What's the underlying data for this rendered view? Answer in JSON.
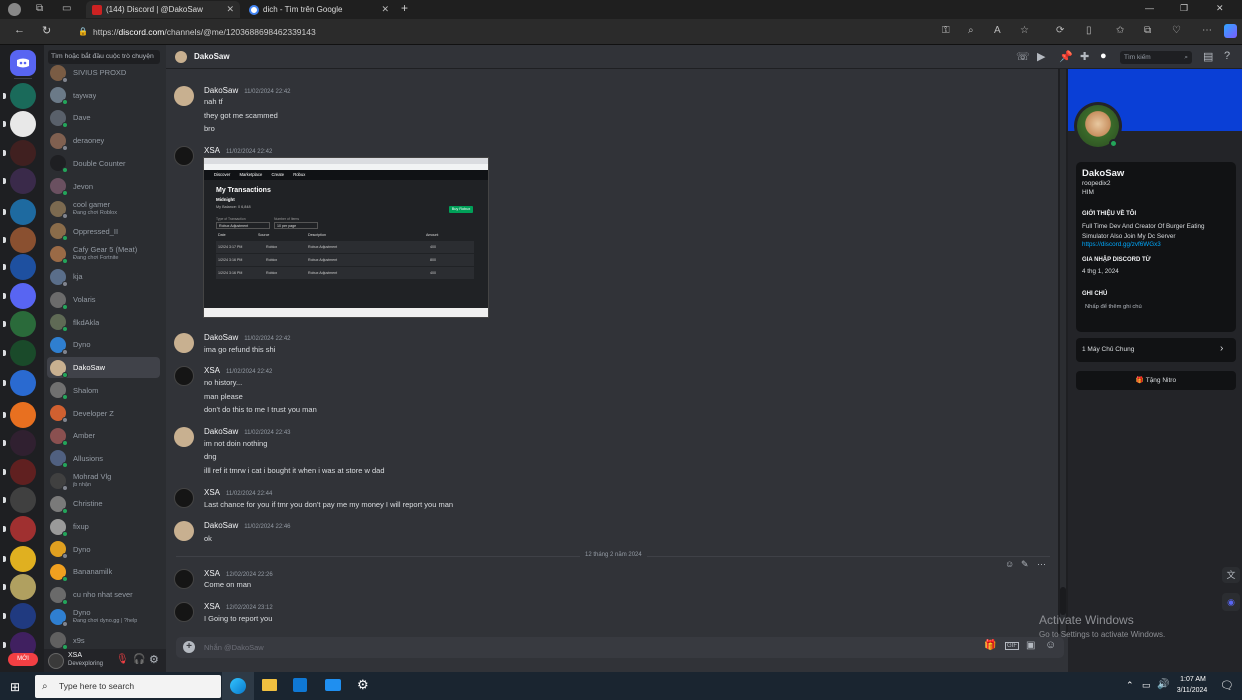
{
  "browser": {
    "tabs": [
      {
        "title": "(144) Discord | @DakoSaw"
      },
      {
        "title": "dich - Tìm trên Google"
      }
    ],
    "url": "https://discord.com/channels/@me/1203688698462339143",
    "url_host": "discord.com",
    "url_prefix": "https://",
    "url_path": "/channels/@me/1203688698462339143"
  },
  "dm_sidebar": {
    "search_placeholder": "Tìm hoặc bắt đầu cuộc trò chuyện",
    "items": [
      {
        "name": "SIVIUS PROXD",
        "sub": "",
        "color": "#7a5c44"
      },
      {
        "name": "tayway",
        "sub": "",
        "color": "#6b7a88"
      },
      {
        "name": "Dave",
        "sub": "",
        "color": "#59606a"
      },
      {
        "name": "deraoney",
        "sub": "",
        "color": "#806050"
      },
      {
        "name": "Double Counter",
        "sub": "",
        "color": "#1e1f22"
      },
      {
        "name": "Jevon",
        "sub": "",
        "color": "#6a5060"
      },
      {
        "name": "cool gamer",
        "sub": "Đang chơi Roblox",
        "color": "#7c6a50"
      },
      {
        "name": "Oppressed_II",
        "sub": "",
        "color": "#8a6c4a"
      },
      {
        "name": "Cafy Gear 5 (Meat)",
        "sub": "Đang chơi Fortnite",
        "color": "#9a6a46"
      },
      {
        "name": "kja",
        "sub": "",
        "color": "#5a6e8a"
      },
      {
        "name": "Volaris",
        "sub": "",
        "color": "#6b6b6b"
      },
      {
        "name": "flkdAkla",
        "sub": "",
        "color": "#5f6a55"
      },
      {
        "name": "Dyno",
        "sub": "",
        "color": "#2f7fd0"
      },
      {
        "name": "DakoSaw",
        "sub": "",
        "color": "#c8b090"
      },
      {
        "name": "Shalom",
        "sub": "",
        "color": "#707070"
      },
      {
        "name": "Developer Z",
        "sub": "",
        "color": "#d06030"
      },
      {
        "name": "Amber",
        "sub": "",
        "color": "#8a5050"
      },
      {
        "name": "Allusions",
        "sub": "",
        "color": "#506080"
      },
      {
        "name": "Mohrad Vlg",
        "sub": "jb nhận",
        "color": "#404040"
      },
      {
        "name": "Christine",
        "sub": "",
        "color": "#7a7a7a"
      },
      {
        "name": "fixup",
        "sub": "",
        "color": "#9a9a9a"
      },
      {
        "name": "Dyno",
        "sub": "",
        "color": "#e0a020"
      },
      {
        "name": "Bananamilk",
        "sub": "",
        "color": "#f0a020"
      },
      {
        "name": "cu nho nhat sever",
        "sub": "",
        "color": "#6a6a6a"
      },
      {
        "name": "Dyno",
        "sub": "Đang chơi dyno.gg | ?help",
        "color": "#2f7fd0"
      },
      {
        "name": "x9s",
        "sub": "",
        "color": "#606060"
      }
    ]
  },
  "user_panel": {
    "name": "XSA",
    "status": "Devexploring",
    "badge_new": "MỚI"
  },
  "header": {
    "channel_name": "DakoSaw",
    "search_placeholder": "Tìm kiếm"
  },
  "messages": [
    {
      "author": "DakoSaw",
      "time": "11/02/2024 22:42",
      "lines": [
        "nah tf",
        "they got me scammed",
        "bro"
      ]
    },
    {
      "author": "XSA",
      "time": "11/02/2024 22:42",
      "lines": []
    },
    {
      "author": "DakoSaw",
      "time": "11/02/2024 22:42",
      "lines": [
        "ima go refund this shi"
      ]
    },
    {
      "author": "XSA",
      "time": "11/02/2024 22:42",
      "lines": [
        "no history...",
        "man please",
        "don't do this to me I trust you man"
      ]
    },
    {
      "author": "DakoSaw",
      "time": "11/02/2024 22:43",
      "lines": [
        "im not doin nothing",
        "dng",
        "illl ref it tmrw i cat i bought it when i was at store w dad"
      ]
    },
    {
      "author": "XSA",
      "time": "11/02/2024 22:44",
      "lines": [
        "Last chance for you if tmr you don't pay me my money I will report you man"
      ]
    },
    {
      "author": "DakoSaw",
      "time": "11/02/2024 22:46",
      "lines": [
        "ok"
      ]
    },
    {
      "author": "XSA",
      "time": "12/02/2024 22:26",
      "lines": [
        "Come on man"
      ]
    },
    {
      "author": "XSA",
      "time": "12/02/2024 23:12",
      "lines": [
        "I Going to report you"
      ]
    }
  ],
  "date_divider": "12 tháng 2 năm 2024",
  "attachment": {
    "title": "My Transactions",
    "subtitle": "Midnight",
    "balance_label": "My Balance: 0 6,848",
    "button": "Buy Robux",
    "filter1_label": "Type of Transaction",
    "filter1_value": "Robux Adjustment",
    "filter2_label": "Number of Items",
    "filter2_value": "10 per page",
    "columns": [
      "Date",
      "Source",
      "Description",
      "Amount"
    ],
    "rows": [
      {
        "date": "1/2/24 3:17 PM",
        "source": "Roblox",
        "desc": "Robux Adjustment",
        "amount": "400"
      },
      {
        "date": "1/2/24 3:16 PM",
        "source": "Roblox",
        "desc": "Robux Adjustment",
        "amount": "800"
      },
      {
        "date": "1/2/24 3:16 PM",
        "source": "Roblox",
        "desc": "Robux Adjustment",
        "amount": "400"
      }
    ],
    "nav": [
      "Discover",
      "Marketplace",
      "Create",
      "Robux"
    ]
  },
  "composer": {
    "placeholder": "Nhắn @DakoSaw"
  },
  "profile": {
    "display_name": "DakoSaw",
    "username": "roopedix2",
    "pronouns": "HIM",
    "about_heading": "GIỚI THIỆU VỀ TÔI",
    "about_line1": "Full Time Dev And Creator Of Burger Eating",
    "about_line2": "Simulator Also Join My Dc Server",
    "about_link": "https://discord.gg/zvf6WGx3",
    "member_heading": "GIA NHẬP DISCORD TỪ",
    "member_since": "4 thg 1, 2024",
    "note_heading": "GHI CHÚ",
    "note_placeholder": "Nhấp để thêm ghi chú",
    "mutual_servers": "1 Máy Chủ Chung",
    "nitro_button": "Tặng Nitro",
    "banner_color": "#0a3fd6"
  },
  "watermark": {
    "title": "Activate Windows",
    "subtitle": "Go to Settings to activate Windows."
  },
  "taskbar": {
    "search_placeholder": "Type here to search",
    "time": "1:07 AM",
    "date": "3/11/2024"
  }
}
